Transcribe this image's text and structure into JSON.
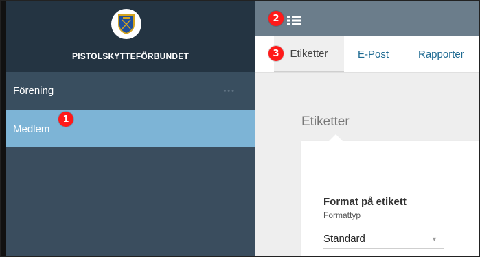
{
  "app": {
    "brand_name": "PISTOLSKYTTEFÖRBUNDET"
  },
  "sidebar": {
    "items": [
      {
        "label": "Förening",
        "more": "•••"
      },
      {
        "label": "Medlem"
      }
    ]
  },
  "tabs": [
    {
      "label": "Etiketter"
    },
    {
      "label": "E-Post"
    },
    {
      "label": "Rapporter"
    }
  ],
  "content": {
    "section_title": "Etiketter",
    "card": {
      "heading": "Format på etikett",
      "subheading": "Formattyp",
      "select_value": "Standard",
      "caret": "▼"
    }
  },
  "markers": [
    {
      "number": "1"
    },
    {
      "number": "2"
    },
    {
      "number": "3"
    }
  ],
  "colors": {
    "sidebar_bg": "#2d3f4f",
    "active_item": "#7db4d6",
    "topbar": "#6b7d8b",
    "link": "#1e6a92",
    "marker": "#ff1a1a"
  },
  "icons": {
    "logo": "federation-shield-logo",
    "menu": "list-menu-icon"
  }
}
